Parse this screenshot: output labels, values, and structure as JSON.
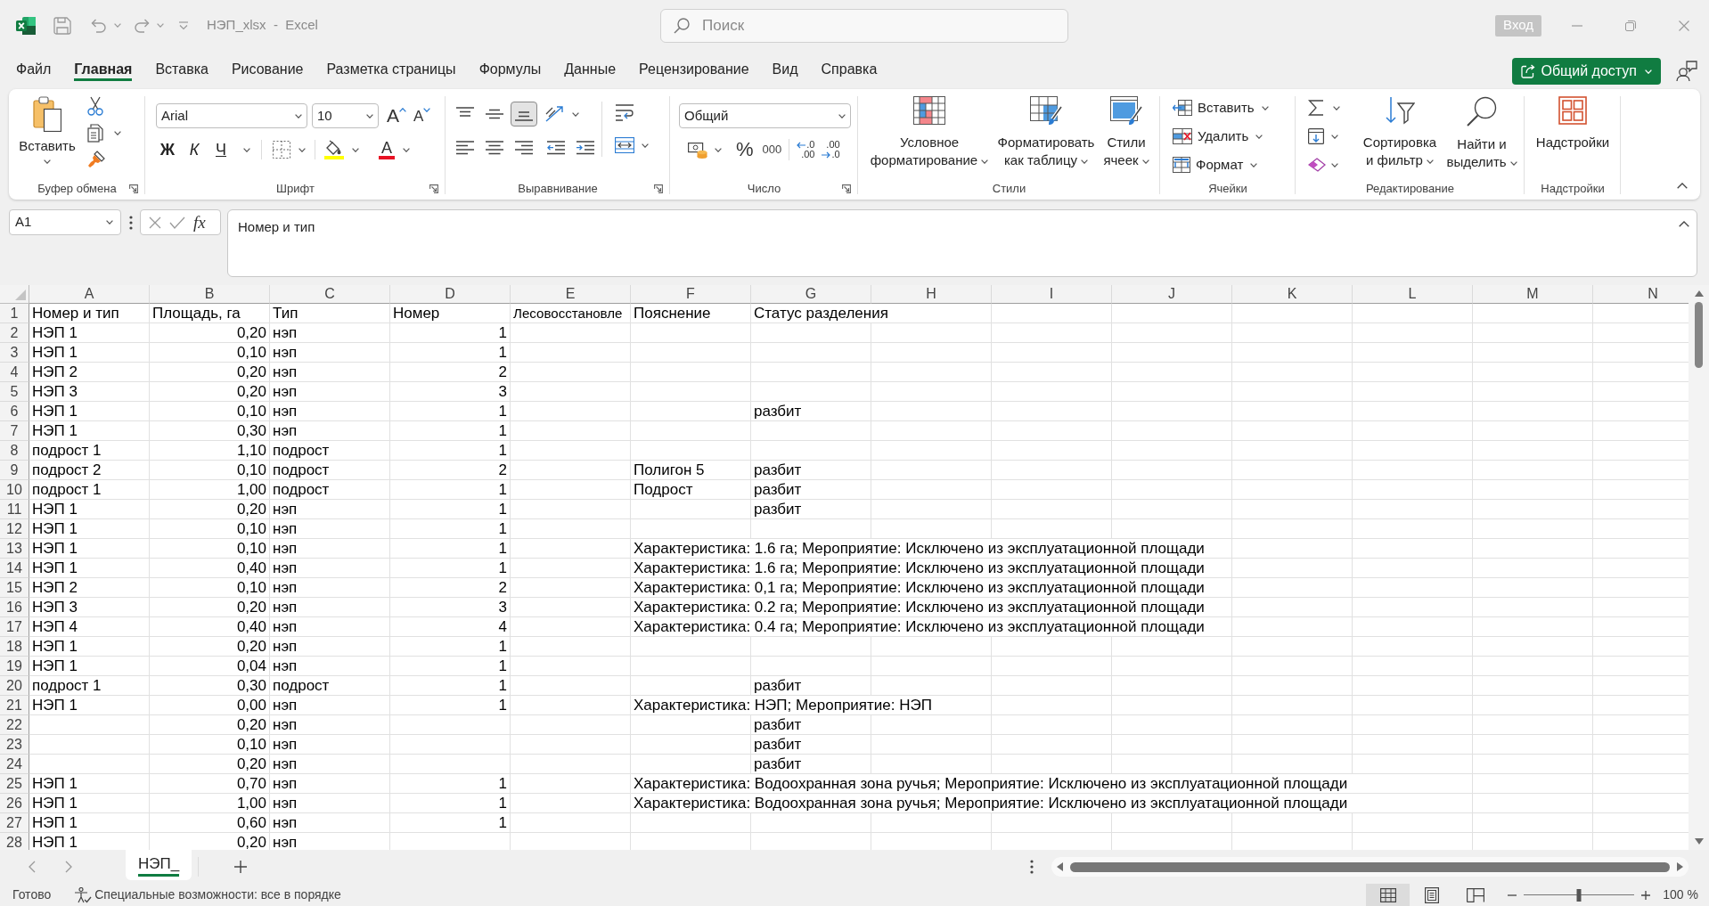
{
  "title_bar": {
    "title": "НЭП_xlsx  -  Excel",
    "search": {
      "placeholder": "Поиск"
    },
    "sign_in": "Вход"
  },
  "menu_tabs": [
    {
      "label": "Файл",
      "selected": false
    },
    {
      "label": "Главная",
      "selected": true
    },
    {
      "label": "Вставка",
      "selected": false
    },
    {
      "label": "Рисование",
      "selected": false
    },
    {
      "label": "Разметка страницы",
      "selected": false
    },
    {
      "label": "Формулы",
      "selected": false
    },
    {
      "label": "Данные",
      "selected": false
    },
    {
      "label": "Рецензирование",
      "selected": false
    },
    {
      "label": "Вид",
      "selected": false
    },
    {
      "label": "Справка",
      "selected": false
    }
  ],
  "share_button": "Общий доступ",
  "ribbon": {
    "clipboard": {
      "label": "Буфер обмена",
      "paste": "Вставить"
    },
    "font": {
      "label": "Шрифт",
      "font_name": "Arial",
      "font_size": "10",
      "grow": "A",
      "shrink": "A",
      "styles": [
        {
          "kind": "bold",
          "label": "Ж"
        },
        {
          "kind": "italic",
          "label": "К"
        },
        {
          "kind": "underline",
          "label": "Ч"
        }
      ],
      "font_color": "A"
    },
    "alignment": {
      "label": "Выравнивание",
      "vertical": [
        {
          "kind": "top",
          "selected": false
        },
        {
          "kind": "middle",
          "selected": false
        },
        {
          "kind": "bottom",
          "selected": true
        }
      ],
      "horizontal": [
        {
          "kind": "left",
          "selected": false
        },
        {
          "kind": "center",
          "selected": false
        },
        {
          "kind": "right",
          "selected": false
        }
      ]
    },
    "number": {
      "label": "Число",
      "format": "Общий",
      "percent": "%",
      "thousands": "000",
      "decimals": [
        {
          "kind": "increase",
          "top": ".0",
          "bottom": ".00"
        },
        {
          "kind": "decrease",
          "top": ".00",
          "bottom": ".0"
        }
      ]
    },
    "styles": {
      "label": "Стили",
      "buttons": [
        {
          "kind": "conditional",
          "label": "Условное форматирование"
        },
        {
          "kind": "table",
          "label": "Форматировать как таблицу"
        },
        {
          "kind": "cell_styles",
          "label": "Стили ячеек"
        }
      ]
    },
    "cells": {
      "label": "Ячейки",
      "buttons": [
        {
          "kind": "insert",
          "label": "Вставить"
        },
        {
          "kind": "delete",
          "label": "Удалить"
        },
        {
          "kind": "format",
          "label": "Формат"
        }
      ]
    },
    "editing": {
      "label": "Редактирование",
      "buttons": [
        {
          "kind": "sort",
          "label": "Сортировка и фильтр"
        },
        {
          "kind": "find",
          "label": "Найти и выделить"
        }
      ]
    },
    "addins": {
      "label": "Надстройки",
      "button": "Надстройки"
    }
  },
  "formula_bar": {
    "name_box": "A1",
    "function_button": "fx",
    "formula": "Номер и тип"
  },
  "sheet": {
    "columns": [
      {
        "label": "A",
        "kind": "text"
      },
      {
        "label": "B",
        "kind": "number"
      },
      {
        "label": "C",
        "kind": "text"
      },
      {
        "label": "D",
        "kind": "number"
      },
      {
        "label": "E",
        "kind": "text"
      },
      {
        "label": "F",
        "kind": "text"
      },
      {
        "label": "G",
        "kind": "text"
      },
      {
        "label": "H",
        "kind": "text"
      },
      {
        "label": "I",
        "kind": "text"
      },
      {
        "label": "J",
        "kind": "text"
      },
      {
        "label": "K",
        "kind": "text"
      },
      {
        "label": "L",
        "kind": "text"
      },
      {
        "label": "M",
        "kind": "text"
      },
      {
        "label": "N",
        "kind": "text"
      }
    ],
    "rows": [
      {
        "number": "1",
        "kind": "header",
        "cells": [
          "Номер и тип",
          "Площадь, га",
          "Тип",
          "Номер",
          "Лесовосстановле",
          "Пояснение",
          "Статус разделения"
        ]
      },
      {
        "number": "2",
        "kind": "data",
        "cells": [
          "НЭП 1",
          "0,20",
          "нэп",
          "1"
        ]
      },
      {
        "number": "3",
        "kind": "data",
        "cells": [
          "НЭП 1",
          "0,10",
          "нэп",
          "1"
        ]
      },
      {
        "number": "4",
        "kind": "data",
        "cells": [
          "НЭП 2",
          "0,20",
          "нэп",
          "2"
        ]
      },
      {
        "number": "5",
        "kind": "data",
        "cells": [
          "НЭП 3",
          "0,20",
          "нэп",
          "3"
        ]
      },
      {
        "number": "6",
        "kind": "data",
        "cells": [
          "НЭП 1",
          "0,10",
          "нэп",
          "1",
          null,
          null,
          "разбит"
        ]
      },
      {
        "number": "7",
        "kind": "data",
        "cells": [
          "НЭП 1",
          "0,30",
          "нэп",
          "1"
        ]
      },
      {
        "number": "8",
        "kind": "data",
        "cells": [
          "подрост 1",
          "1,10",
          "подрост",
          "1"
        ]
      },
      {
        "number": "9",
        "kind": "data",
        "cells": [
          "подрост 2",
          "0,10",
          "подрост",
          "2",
          null,
          "Полигон 5",
          "разбит"
        ]
      },
      {
        "number": "10",
        "kind": "data",
        "cells": [
          "подрост 1",
          "1,00",
          "подрост",
          "1",
          null,
          "Подрост",
          "разбит"
        ]
      },
      {
        "number": "11",
        "kind": "data",
        "cells": [
          "НЭП 1",
          "0,20",
          "нэп",
          "1",
          null,
          null,
          "разбит"
        ]
      },
      {
        "number": "12",
        "kind": "data",
        "cells": [
          "НЭП 1",
          "0,10",
          "нэп",
          "1"
        ]
      },
      {
        "number": "13",
        "kind": "data",
        "cells": [
          "НЭП 1",
          "0,10",
          "нэп",
          "1",
          null,
          "Характеристика: 1.6 га; Мероприятие: Исключено из эксплуатационной площади"
        ]
      },
      {
        "number": "14",
        "kind": "data",
        "cells": [
          "НЭП 1",
          "0,40",
          "нэп",
          "1",
          null,
          "Характеристика: 1.6 га; Мероприятие: Исключено из эксплуатационной площади"
        ]
      },
      {
        "number": "15",
        "kind": "data",
        "cells": [
          "НЭП 2",
          "0,10",
          "нэп",
          "2",
          null,
          "Характеристика: 0,1 га; Мероприятие: Исключено из эксплуатационной площади"
        ]
      },
      {
        "number": "16",
        "kind": "data",
        "cells": [
          "НЭП 3",
          "0,20",
          "нэп",
          "3",
          null,
          "Характеристика: 0.2 га; Мероприятие: Исключено из эксплуатационной площади"
        ]
      },
      {
        "number": "17",
        "kind": "data",
        "cells": [
          "НЭП 4",
          "0,40",
          "нэп",
          "4",
          null,
          "Характеристика: 0.4 га; Мероприятие: Исключено из эксплуатационной площади"
        ]
      },
      {
        "number": "18",
        "kind": "data",
        "cells": [
          "НЭП 1",
          "0,20",
          "нэп",
          "1"
        ]
      },
      {
        "number": "19",
        "kind": "data",
        "cells": [
          "НЭП 1",
          "0,04",
          "нэп",
          "1"
        ]
      },
      {
        "number": "20",
        "kind": "data",
        "cells": [
          "подрост 1",
          "0,30",
          "подрост",
          "1",
          null,
          null,
          "разбит"
        ]
      },
      {
        "number": "21",
        "kind": "data",
        "cells": [
          "НЭП 1",
          "0,00",
          "нэп",
          "1",
          null,
          "Характеристика: НЭП; Мероприятие: НЭП"
        ]
      },
      {
        "number": "22",
        "kind": "data",
        "cells": [
          null,
          "0,20",
          "нэп",
          null,
          null,
          null,
          "разбит"
        ]
      },
      {
        "number": "23",
        "kind": "data",
        "cells": [
          null,
          "0,10",
          "нэп",
          null,
          null,
          null,
          "разбит"
        ]
      },
      {
        "number": "24",
        "kind": "data",
        "cells": [
          null,
          "0,20",
          "нэп",
          null,
          null,
          null,
          "разбит"
        ]
      },
      {
        "number": "25",
        "kind": "data",
        "cells": [
          "НЭП 1",
          "0,70",
          "нэп",
          "1",
          null,
          "Характеристика: Водоохранная зона ручья; Мероприятие: Исключено из эксплуатационной площади"
        ]
      },
      {
        "number": "26",
        "kind": "data",
        "cells": [
          "НЭП 1",
          "1,00",
          "нэп",
          "1",
          null,
          "Характеристика: Водоохранная зона ручья; Мероприятие: Исключено из эксплуатационной площади"
        ]
      },
      {
        "number": "27",
        "kind": "data",
        "cells": [
          "НЭП 1",
          "0,60",
          "нэп",
          "1"
        ]
      },
      {
        "number": "28",
        "kind": "data",
        "cells": [
          "НЭП 1",
          "0,20",
          "нэп"
        ]
      }
    ]
  },
  "sheet_tabs": [
    {
      "label": "НЭП_",
      "selected": true
    }
  ],
  "status_bar": {
    "mode": "Готово",
    "accessibility": "Специальные возможности: все в порядке",
    "views": [
      {
        "kind": "normal",
        "selected": true
      },
      {
        "kind": "page_layout",
        "selected": false
      },
      {
        "kind": "page_break",
        "selected": false
      }
    ],
    "zoom_slider": {
      "level": 0.5
    },
    "zoom": "100 %"
  }
}
